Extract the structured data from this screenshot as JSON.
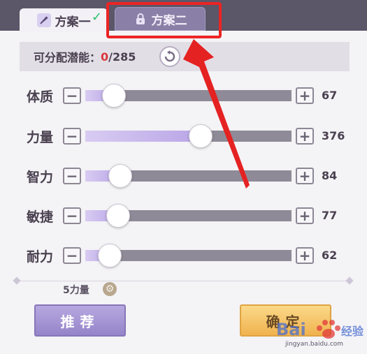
{
  "tabs": [
    {
      "label": "方案一",
      "icon": "quill-icon",
      "selected": true
    },
    {
      "label": "方案二",
      "icon": "lock-icon",
      "selected": false
    }
  ],
  "potential": {
    "label": "可分配潜能：",
    "current": "0",
    "max": "/285"
  },
  "stats": [
    {
      "label": "体质",
      "value": "67",
      "level": 0.14
    },
    {
      "label": "力量",
      "value": "376",
      "level": 0.56
    },
    {
      "label": "智力",
      "value": "84",
      "level": 0.17
    },
    {
      "label": "敏捷",
      "value": "77",
      "level": 0.16
    },
    {
      "label": "耐力",
      "value": "62",
      "level": 0.12
    }
  ],
  "buttons": {
    "minus": "−",
    "plus": "+",
    "recommend": "推荐",
    "confirm": "确定"
  },
  "hint": "5力量",
  "watermark": {
    "text": "Bai 经验",
    "url": "jingyan.baidu.com"
  },
  "colors": {
    "highlight": "#ec2424",
    "fill": "#b9a5e6",
    "track": "#8f8a97"
  }
}
